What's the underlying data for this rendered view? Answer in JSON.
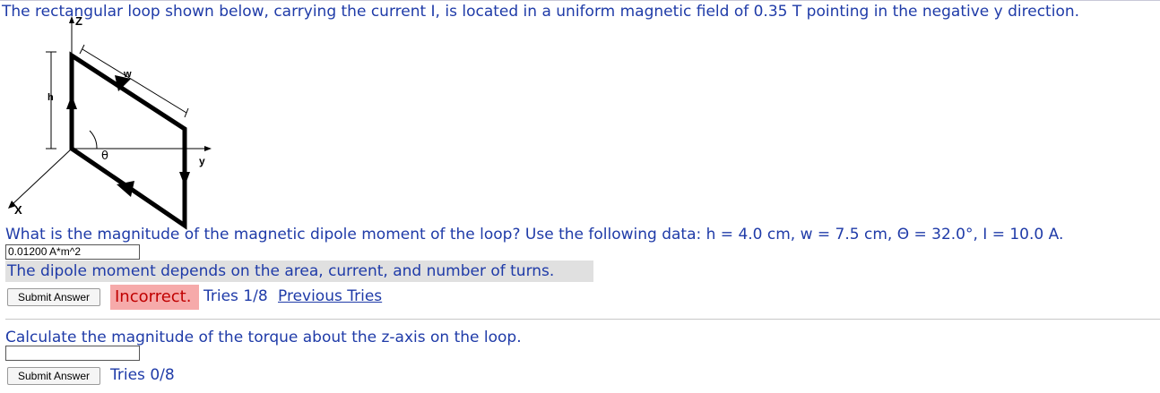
{
  "problem": {
    "intro": "The rectangular loop shown below, carrying the current I, is located in a uniform magnetic field of 0.35 T pointing in the negative y direction."
  },
  "figure": {
    "labels": {
      "z": "Z",
      "x": "X",
      "y": "y",
      "h": "h",
      "w": "w",
      "theta": "θ"
    }
  },
  "question1": {
    "text": "What is the magnitude of the magnetic dipole moment of the loop? Use the following data: h = 4.0 cm, w = 7.5 cm, Θ = 32.0°, I = 10.0 A.",
    "answer_value": "0.01200 A*m^2",
    "hint": "The dipole moment depends on the area, current, and number of turns.",
    "submit_label": "Submit Answer",
    "status": "Incorrect.",
    "tries": "Tries 1/8",
    "previous_tries": "Previous Tries"
  },
  "question2": {
    "text": "Calculate the magnitude of the torque about the z-axis on the loop.",
    "answer_value": "",
    "submit_label": "Submit Answer",
    "tries": "Tries 0/8"
  },
  "colors": {
    "text": "#1f3ba8",
    "incorrect_bg": "#f6aaaa",
    "incorrect_text": "#c00000",
    "hint_bg": "#e0e0e0"
  }
}
